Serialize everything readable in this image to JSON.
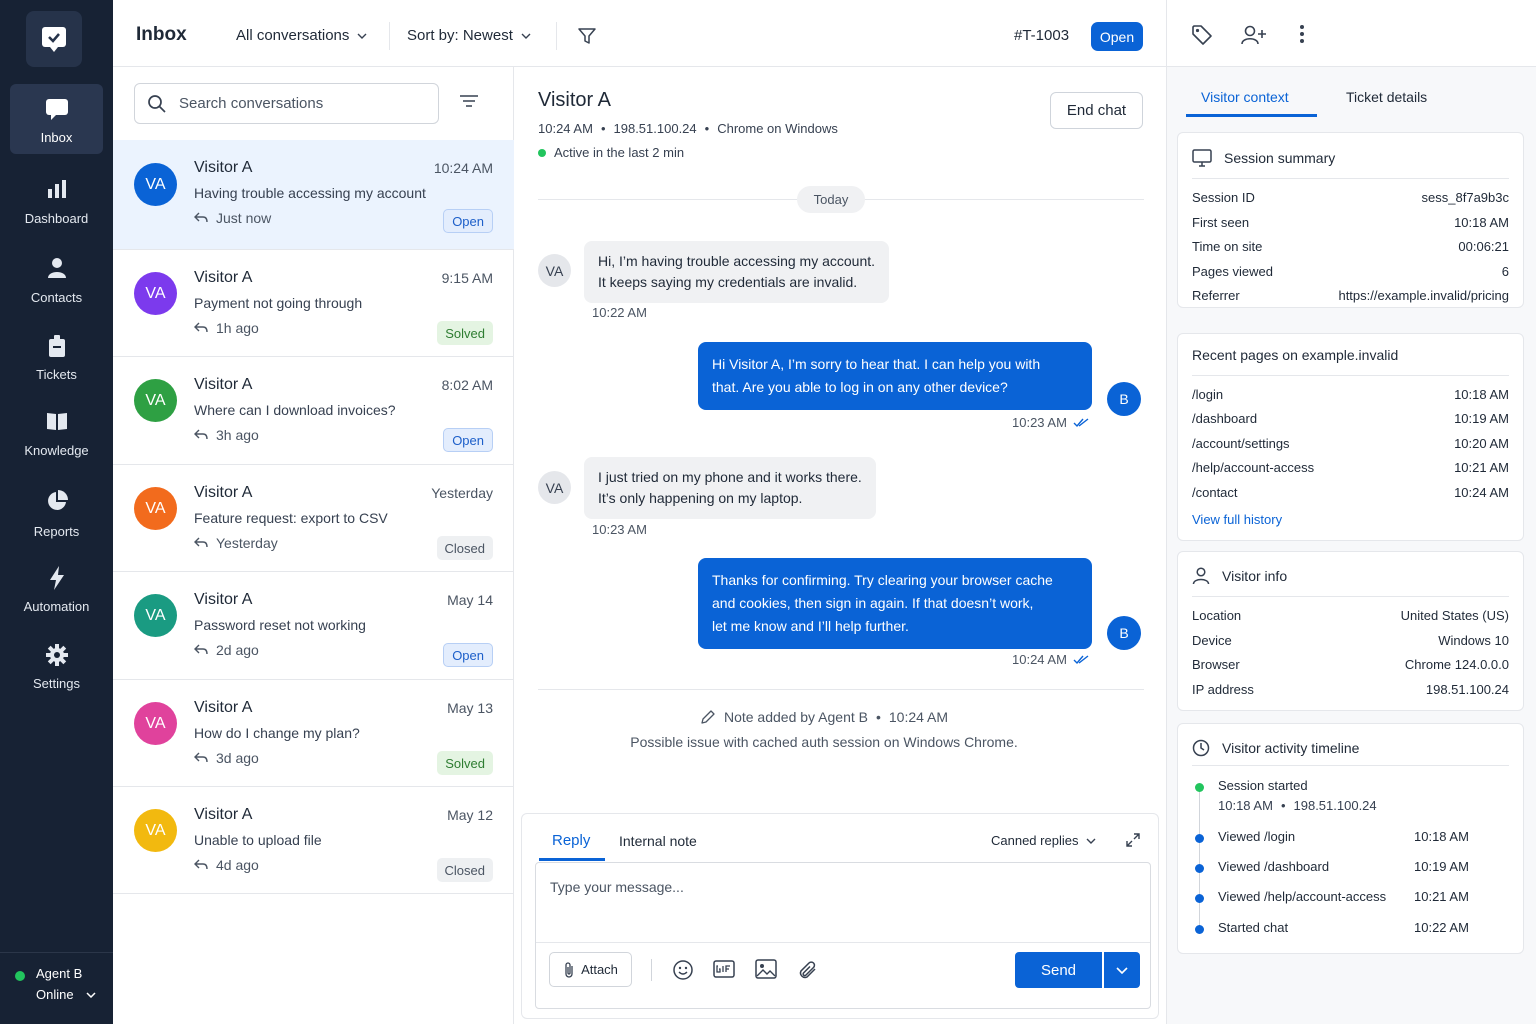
{
  "nav": {
    "items": [
      {
        "label": "Inbox",
        "icon": "chat-icon"
      },
      {
        "label": "Dashboard",
        "icon": "bar-chart-icon"
      },
      {
        "label": "Contacts",
        "icon": "person-icon"
      },
      {
        "label": "Tickets",
        "icon": "ticket-icon"
      },
      {
        "label": "Knowledge",
        "icon": "book-icon"
      },
      {
        "label": "Reports",
        "icon": "pie-chart-icon"
      },
      {
        "label": "Automation",
        "icon": "lightning-icon"
      },
      {
        "label": "Settings",
        "icon": "gear-icon"
      }
    ],
    "agent": {
      "name": "Agent B",
      "status": "Online"
    }
  },
  "header": {
    "title": "Inbox",
    "filter": "All conversations",
    "sort": "Sort by: Newest",
    "ticket_id": "#T-1003",
    "ticket_status": "Open"
  },
  "list": {
    "search_placeholder": "Search conversations",
    "conversations": [
      {
        "initials": "VA",
        "name": "Visitor A",
        "time": "10:24 AM",
        "preview": "Having trouble accessing my account",
        "ago": "Just now",
        "status": "Open",
        "color": "#0a63d6"
      },
      {
        "initials": "VA",
        "name": "Visitor A",
        "time": "9:15 AM",
        "preview": "Payment not going through",
        "ago": "1h ago",
        "status": "Solved",
        "color": "#7c3aed"
      },
      {
        "initials": "VA",
        "name": "Visitor A",
        "time": "8:02 AM",
        "preview": "Where can I download invoices?",
        "ago": "3h ago",
        "status": "Open",
        "color": "#2ea043"
      },
      {
        "initials": "VA",
        "name": "Visitor A",
        "time": "Yesterday",
        "preview": "Feature request: export to CSV",
        "ago": "Yesterday",
        "status": "Closed",
        "color": "#f26b1d"
      },
      {
        "initials": "VA",
        "name": "Visitor A",
        "time": "May 14",
        "preview": "Password reset not working",
        "ago": "2d ago",
        "status": "Open",
        "color": "#1a9b82"
      },
      {
        "initials": "VA",
        "name": "Visitor A",
        "time": "May 13",
        "preview": "How do I change my plan?",
        "ago": "3d ago",
        "status": "Solved",
        "color": "#e0429c"
      },
      {
        "initials": "VA",
        "name": "Visitor A",
        "time": "May 12",
        "preview": "Unable to upload file",
        "ago": "4d ago",
        "status": "Closed",
        "color": "#f2b90f"
      }
    ]
  },
  "chat": {
    "visitor": "Visitor A",
    "meta_time": "10:24 AM",
    "meta_ip": "198.51.100.24",
    "meta_browser": "Chrome on Windows",
    "active": "Active in the last 2 min",
    "end_chat": "End chat",
    "day_label": "Today",
    "messages": [
      {
        "from": "visitor",
        "initials": "VA",
        "lines": [
          "Hi, I’m having trouble accessing my account.",
          "It keeps saying my credentials are invalid."
        ],
        "time": "10:22 AM"
      },
      {
        "from": "agent",
        "initials": "B",
        "lines": [
          "Hi Visitor A, I’m sorry to hear that. I can help you with",
          "that. Are you able to log in on any other device?"
        ],
        "time": "10:23 AM"
      },
      {
        "from": "visitor",
        "initials": "VA",
        "lines": [
          "I just tried on my phone and it works there.",
          "It’s only happening on my laptop."
        ],
        "time": "10:23 AM"
      },
      {
        "from": "agent",
        "initials": "B",
        "lines": [
          "Thanks for confirming. Try clearing your browser cache",
          "and cookies, then sign in again. If that doesn’t work,",
          "let me know and I’ll help further."
        ],
        "time": "10:24 AM"
      }
    ],
    "note_by": "Note added by Agent B",
    "note_time": "10:24 AM",
    "note_text": "Possible issue with cached auth session on Windows Chrome.",
    "composer": {
      "tab_reply": "Reply",
      "tab_note": "Internal note",
      "canned": "Canned replies",
      "placeholder": "Type your message...",
      "attach": "Attach",
      "send": "Send"
    }
  },
  "right": {
    "tab_context": "Visitor context",
    "tab_details": "Ticket details",
    "session": {
      "title": "Session summary",
      "rows": [
        {
          "k": "Session ID",
          "v": "sess_8f7a9b3c"
        },
        {
          "k": "First seen",
          "v": "10:18 AM"
        },
        {
          "k": "Time on site",
          "v": "00:06:21"
        },
        {
          "k": "Pages viewed",
          "v": "6"
        },
        {
          "k": "Referrer",
          "v": "https://example.invalid/pricing"
        }
      ]
    },
    "pages": {
      "title": "Recent pages on example.invalid",
      "rows": [
        {
          "k": "/login",
          "v": "10:18 AM"
        },
        {
          "k": "/dashboard",
          "v": "10:19 AM"
        },
        {
          "k": "/account/settings",
          "v": "10:20 AM"
        },
        {
          "k": "/help/account-access",
          "v": "10:21 AM"
        },
        {
          "k": "/contact",
          "v": "10:24 AM"
        }
      ],
      "link": "View full history"
    },
    "info": {
      "title": "Visitor info",
      "rows": [
        {
          "k": "Location",
          "v": "United States (US)"
        },
        {
          "k": "Device",
          "v": "Windows 10"
        },
        {
          "k": "Browser",
          "v": "Chrome 124.0.0.0"
        },
        {
          "k": "IP address",
          "v": "198.51.100.24"
        }
      ]
    },
    "timeline": {
      "title": "Visitor activity timeline",
      "start_title": "Session started",
      "start_time": "10:18 AM",
      "start_ip": "198.51.100.24",
      "events": [
        {
          "k": "Viewed /login",
          "v": "10:18 AM"
        },
        {
          "k": "Viewed /dashboard",
          "v": "10:19 AM"
        },
        {
          "k": "Viewed /help/account-access",
          "v": "10:21 AM"
        },
        {
          "k": "Started chat",
          "v": "10:22 AM"
        }
      ]
    }
  }
}
